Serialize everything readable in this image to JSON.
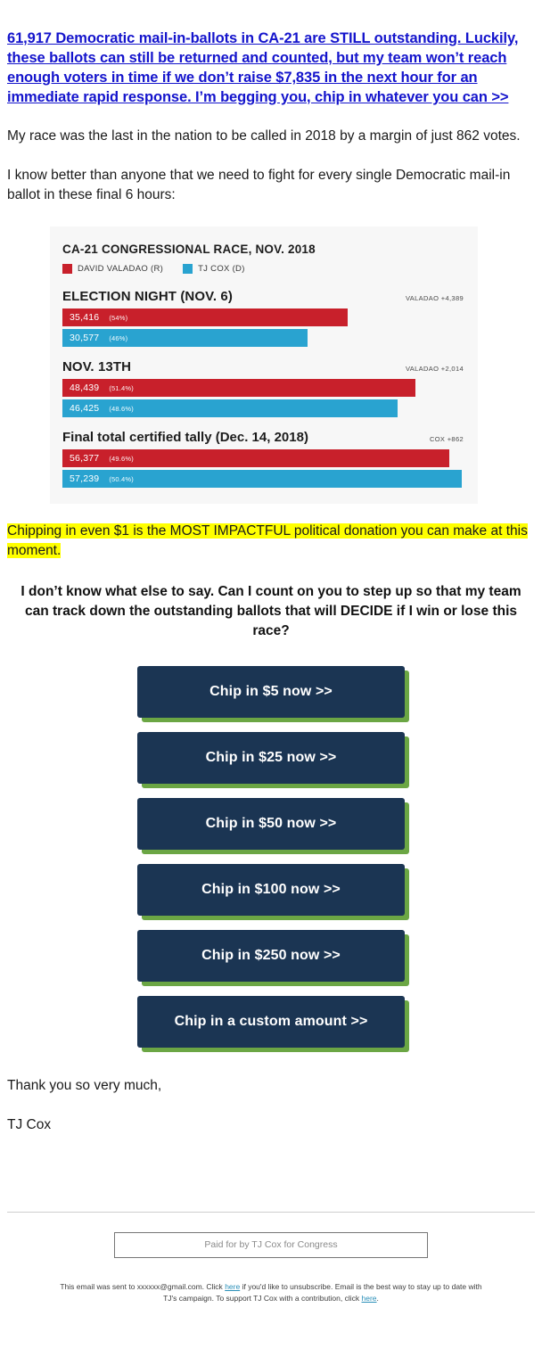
{
  "headline": {
    "text": "61,917 Democratic mail-in-ballots in CA-21 are STILL outstanding. Luckily, these ballots can still be returned and counted, but my team won’t reach enough voters in time if we don’t raise $7,835 in the next hour for an immediate rapid response. I’m begging you, chip in whatever you can >>",
    "color": "#1414cc"
  },
  "paragraphs": {
    "p1": "My race was the last in the nation to be called in 2018 by a margin of just 862 votes.",
    "p2": "I know better than anyone that we need to fight for every single Democratic mail-in ballot in these final 6 hours:"
  },
  "highlight": {
    "text": "Chipping in even $1 is the MOST IMPACTFUL political donation you can make at this moment.",
    "background": "#ffff00"
  },
  "ask": "I don’t know what else to say. Can I count on you to step up so that my team can track down the outstanding ballots that will DECIDE if I win or lose this race?",
  "buttons": [
    {
      "label": "Chip in $5 now >>"
    },
    {
      "label": "Chip in $25 now >>"
    },
    {
      "label": "Chip in $50 now >>"
    },
    {
      "label": "Chip in $100 now >>"
    },
    {
      "label": "Chip in $250 now >>"
    },
    {
      "label": "Chip in a custom amount >>"
    }
  ],
  "button_style": {
    "face": "#1b3553",
    "shadow": "#6ba644",
    "text": "#ffffff"
  },
  "signoff": {
    "thanks": "Thank you so very much,",
    "name": "TJ Cox"
  },
  "footer": {
    "paid_for": "Paid for by TJ Cox for Congress",
    "fineprint_1": "This email was sent to xxxxxx@gmail.com. Click",
    "link_1": "here",
    "fineprint_2": "if you'd like to unsubscribe. Email is the best way to stay up to date with TJ's campaign. To support TJ Cox with a contribution, click",
    "link_2": "here",
    "fineprint_3": "."
  },
  "chart_data": {
    "type": "bar",
    "title": "CA-21 CONGRESSIONAL RACE, NOV. 2018",
    "orientation": "horizontal",
    "grid": false,
    "legend_position": "top",
    "legend": [
      {
        "label": "DAVID VALADAO (R)",
        "color": "#c8202b"
      },
      {
        "label": "TJ COX (D)",
        "color": "#29a3d0"
      }
    ],
    "categories": [
      "ELECTION NIGHT (NOV. 6)",
      "NOV. 13TH",
      "Final total certified tally (Dec. 14, 2018)"
    ],
    "series": [
      {
        "name": "DAVID VALADAO (R)",
        "color": "#c8202b",
        "values": [
          35416,
          48439,
          56377
        ],
        "value_labels": [
          "35,416",
          "48,439",
          "56,377"
        ],
        "pct_labels": [
          "(54%)",
          "(51.4%)",
          "(49.6%)"
        ]
      },
      {
        "name": "TJ COX (D)",
        "color": "#29a3d0",
        "values": [
          30577,
          46425,
          57239
        ],
        "value_labels": [
          "30,577",
          "46,425",
          "57,239"
        ],
        "pct_labels": [
          "(46%)",
          "(48.6%)",
          "(50.4%)"
        ]
      }
    ],
    "groups": [
      {
        "name": "ELECTION NIGHT (NOV. 6)",
        "margin_label": "VALADAO +4,389",
        "bars": [
          {
            "party": "r",
            "votes": "35,416",
            "pct": "(54%)",
            "width_pct": 71
          },
          {
            "party": "b",
            "votes": "30,577",
            "pct": "(46%)",
            "width_pct": 61
          }
        ]
      },
      {
        "name": "NOV. 13TH",
        "margin_label": "VALADAO +2,014",
        "bars": [
          {
            "party": "r",
            "votes": "48,439",
            "pct": "(51.4%)",
            "width_pct": 88
          },
          {
            "party": "b",
            "votes": "46,425",
            "pct": "(48.6%)",
            "width_pct": 83.5
          }
        ]
      },
      {
        "name": "Final total certified tally (Dec. 14, 2018)",
        "margin_label": "COX +862",
        "bars": [
          {
            "party": "r",
            "votes": "56,377",
            "pct": "(49.6%)",
            "width_pct": 96.5
          },
          {
            "party": "b",
            "votes": "57,239",
            "pct": "(50.4%)",
            "width_pct": 99.5
          }
        ]
      }
    ],
    "xlabel": "",
    "ylabel": "",
    "annotations": [
      "VALADAO +4,389",
      "VALADAO +2,014",
      "COX +862"
    ]
  }
}
